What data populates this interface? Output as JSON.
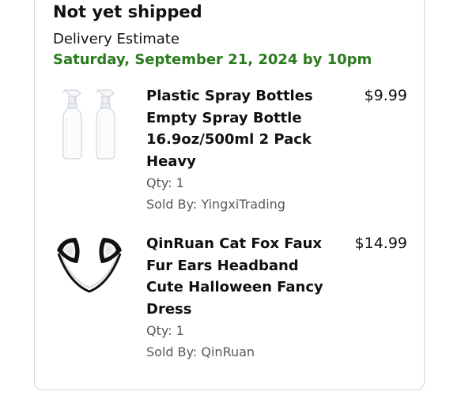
{
  "shipment": {
    "status": "Not yet shipped",
    "delivery_label": "Delivery Estimate",
    "delivery_date": "Saturday, September 21, 2024 by 10pm"
  },
  "items": [
    {
      "title": "Plastic Spray Bottles Empty Spray Bottle 16.9oz/500ml 2 Pack Heavy",
      "price": "$9.99",
      "qty": "Qty: 1",
      "sold_by": "Sold By: YingxiTrading",
      "image": "spray-bottles-thumbnail"
    },
    {
      "title": "QinRuan Cat Fox Faux Fur Ears Headband Cute Halloween Fancy Dress",
      "price": "$14.99",
      "qty": "Qty: 1",
      "sold_by": "Sold By: QinRuan",
      "image": "cat-ears-headband-thumbnail"
    }
  ],
  "colors": {
    "delivery_date": "#2b7a1f",
    "text": "#0f1111",
    "secondary_text": "#565959",
    "card_border": "#d5d9d9"
  }
}
